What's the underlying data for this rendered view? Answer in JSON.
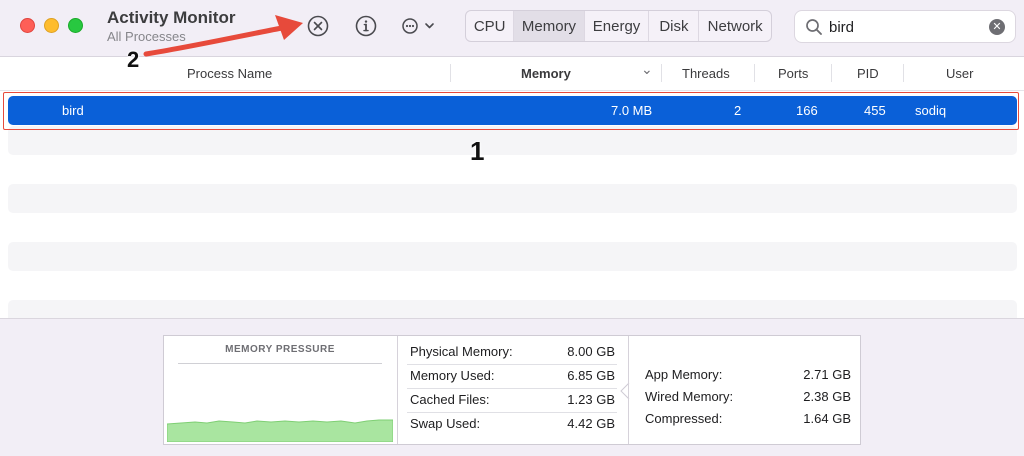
{
  "app": {
    "title": "Activity Monitor",
    "subtitle": "All Processes"
  },
  "toolbar": {
    "icons": [
      "stop-process-icon",
      "info-icon",
      "more-actions-icon",
      "chevron-down-icon"
    ],
    "tabs": [
      {
        "label": "CPU",
        "active": false
      },
      {
        "label": "Memory",
        "active": true
      },
      {
        "label": "Energy",
        "active": false
      },
      {
        "label": "Disk",
        "active": false
      },
      {
        "label": "Network",
        "active": false
      }
    ]
  },
  "search": {
    "value": "bird",
    "clear_glyph": "✕"
  },
  "table": {
    "columns": {
      "process_name": "Process Name",
      "memory": "Memory",
      "threads": "Threads",
      "ports": "Ports",
      "pid": "PID",
      "user": "User"
    },
    "sort_indicator": "⌄",
    "rows": [
      {
        "name": "bird",
        "memory": "7.0 MB",
        "threads": "2",
        "ports": "166",
        "pid": "455",
        "user": "sodiq",
        "selected": true
      }
    ]
  },
  "memory_stats": {
    "pressure_title": "MEMORY PRESSURE",
    "pressure_color": "#a9e5a0",
    "physical_memory": {
      "label": "Physical Memory:",
      "value": "8.00 GB"
    },
    "memory_used": {
      "label": "Memory Used:",
      "value": "6.85 GB"
    },
    "cached_files": {
      "label": "Cached Files:",
      "value": "1.23 GB"
    },
    "swap_used": {
      "label": "Swap Used:",
      "value": "4.42 GB"
    },
    "app_memory": {
      "label": "App Memory:",
      "value": "2.71 GB"
    },
    "wired_memory": {
      "label": "Wired Memory:",
      "value": "2.38 GB"
    },
    "compressed": {
      "label": "Compressed:",
      "value": "1.64 GB"
    }
  },
  "annotations": {
    "label_1": "1",
    "label_2": "2",
    "color": "#e74a3b"
  }
}
